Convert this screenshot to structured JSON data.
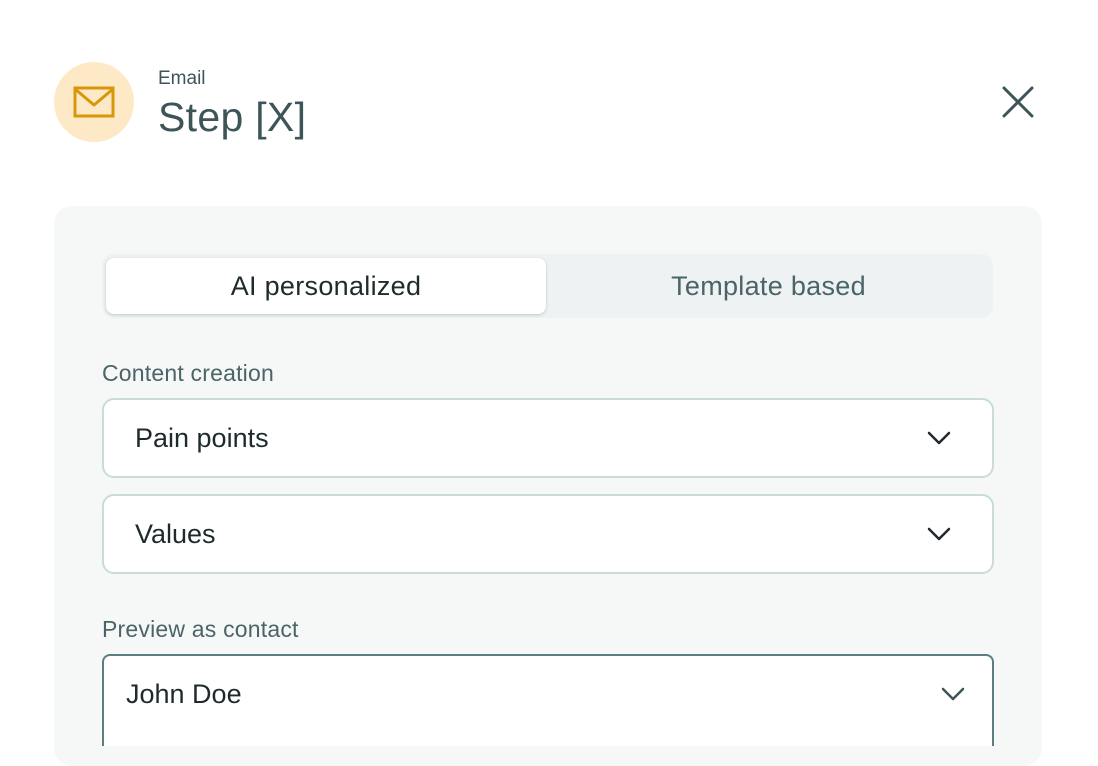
{
  "header": {
    "icon": "mail-icon",
    "kicker": "Email",
    "title": "Step [X]",
    "close_icon": "close-icon"
  },
  "mode_tabs": [
    {
      "label": "AI personalized",
      "active": true
    },
    {
      "label": "Template based",
      "active": false
    }
  ],
  "content_creation": {
    "label": "Content creation",
    "selects": [
      {
        "value": "Pain points",
        "icon": "chevron-down-icon"
      },
      {
        "value": "Values",
        "icon": "chevron-down-icon"
      }
    ]
  },
  "preview": {
    "label": "Preview as contact",
    "value": "John Doe",
    "icon": "chevron-down-icon"
  },
  "colors": {
    "icon_bg": "#fde9c6",
    "icon_stroke": "#d8970a",
    "heading": "#3d5559",
    "panel_bg": "#f6f8f7",
    "field_border": "#c9dbdb"
  }
}
